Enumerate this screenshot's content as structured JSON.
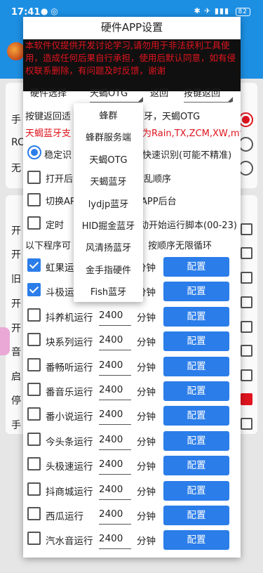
{
  "status": {
    "time": "17:41",
    "battery": "82"
  },
  "dialog": {
    "title": "硬件APP设置",
    "disclaimer": "本软件仅提供开发讨论学习,请勿用于非法获利工具使用，造成任何后果自行承担，使用后默认同意，如有侵权联系删除，有问题及时反馈，谢谢",
    "hardware_label": "硬件选择",
    "hardware_value": "天蝎OTG",
    "back_label": "返回",
    "back_key_value": "按键返回",
    "hint_line": "按键返回适",
    "hint_line_right": "牙，天蝎OTG",
    "red_line_left": "天蝎蓝牙支",
    "red_line_right": "为Rain,TX,ZCM,XW,mf",
    "stable_label": "稳定识",
    "fast_label": "快速识别(可能不精准)",
    "open_label": "打开后",
    "open_right": "乱顺序",
    "switch_label": "切换AP",
    "switch_right": "APP后台",
    "timer_label": "定时",
    "timer_right": "动开始运行脚本(00-23)",
    "programs_label": "以下程序可",
    "loop_label": "按顺序无限循环"
  },
  "tasks": [
    {
      "name": "虹果运",
      "value": "",
      "unit": "分钟",
      "checked": true,
      "config": "配置"
    },
    {
      "name": "斗极运",
      "value": "",
      "unit": "分钟",
      "checked": true,
      "config": "配置"
    },
    {
      "name": "抖养机运行",
      "value": "2400",
      "unit": "分钟",
      "checked": false,
      "config": "配置"
    },
    {
      "name": "块系列运行",
      "value": "2400",
      "unit": "分钟",
      "checked": false,
      "config": "配置"
    },
    {
      "name": "番畅听运行",
      "value": "2400",
      "unit": "分钟",
      "checked": false,
      "config": "配置"
    },
    {
      "name": "番音乐运行",
      "value": "2400",
      "unit": "分钟",
      "checked": false,
      "config": "配置"
    },
    {
      "name": "番小说运行",
      "value": "2400",
      "unit": "分钟",
      "checked": false,
      "config": "配置"
    },
    {
      "name": "今头条运行",
      "value": "2400",
      "unit": "分钟",
      "checked": false,
      "config": "配置"
    },
    {
      "name": "头极速运行",
      "value": "2400",
      "unit": "分钟",
      "checked": false,
      "config": "配置"
    },
    {
      "name": "抖商城运行",
      "value": "2400",
      "unit": "分钟",
      "checked": false,
      "config": "配置"
    },
    {
      "name": "西瓜运行",
      "value": "2400",
      "unit": "分钟",
      "checked": false,
      "config": "配置"
    },
    {
      "name": "汽水音运行",
      "value": "2400",
      "unit": "分钟",
      "checked": false,
      "config": "配置"
    }
  ],
  "dropdown": {
    "options": [
      "蜂群",
      "蜂群服务端",
      "天蝎OTG",
      "天蝎蓝牙",
      "lydjp蓝牙",
      "HID掘金蓝牙",
      "风清扬蓝牙",
      "金手指硬件",
      "Fish蓝牙"
    ]
  },
  "background": {
    "left_chars": [
      "手",
      "RC",
      "无",
      "开",
      "开",
      "旧",
      "开",
      "开",
      "音",
      "启",
      "停",
      "手"
    ]
  },
  "colors": {
    "accent": "#2b7de9",
    "warning_red": "#e0141e",
    "appbar": "#1d8fe3"
  }
}
